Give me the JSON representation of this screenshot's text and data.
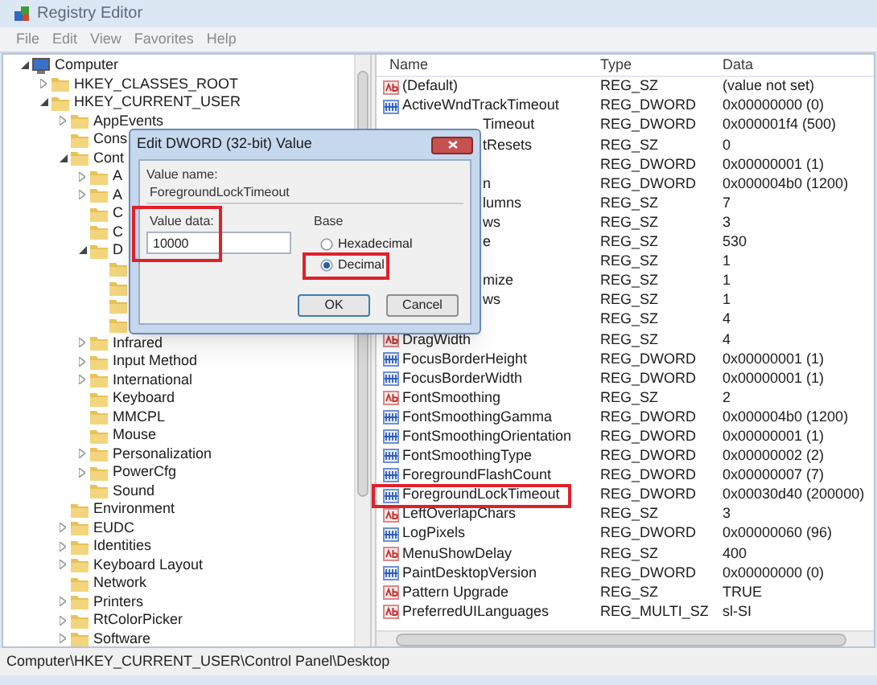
{
  "window": {
    "title": "Registry Editor"
  },
  "menu": [
    "File",
    "Edit",
    "View",
    "Favorites",
    "Help"
  ],
  "tree": [
    {
      "label": "Computer",
      "kind": "computer",
      "expanded": true,
      "children": [
        {
          "label": "HKEY_CLASSES_ROOT",
          "kind": "folder",
          "expanded": false
        },
        {
          "label": "HKEY_CURRENT_USER",
          "kind": "folder",
          "expanded": true,
          "children": [
            {
              "label": "AppEvents",
              "kind": "folder",
              "expanded": false
            },
            {
              "label": "Cons",
              "kind": "folder"
            },
            {
              "label": "Cont",
              "kind": "folder",
              "expanded": true,
              "children": [
                {
                  "label": "A",
                  "kind": "folder",
                  "expanded": false
                },
                {
                  "label": "A",
                  "kind": "folder",
                  "expanded": false
                },
                {
                  "label": "C",
                  "kind": "folder"
                },
                {
                  "label": "C",
                  "kind": "folder"
                },
                {
                  "label": "D",
                  "kind": "folder",
                  "expanded": true,
                  "children": [
                    {
                      "kind": "folder"
                    },
                    {
                      "kind": "folder"
                    },
                    {
                      "kind": "folder"
                    },
                    {
                      "kind": "folder"
                    }
                  ]
                },
                {
                  "label": "Infrared",
                  "kind": "folder",
                  "expanded": false
                },
                {
                  "label": "Input Method",
                  "kind": "folder",
                  "expanded": false
                },
                {
                  "label": "International",
                  "kind": "folder",
                  "expanded": false
                },
                {
                  "label": "Keyboard",
                  "kind": "folder"
                },
                {
                  "label": "MMCPL",
                  "kind": "folder"
                },
                {
                  "label": "Mouse",
                  "kind": "folder"
                },
                {
                  "label": "Personalization",
                  "kind": "folder",
                  "expanded": false
                },
                {
                  "label": "PowerCfg",
                  "kind": "folder",
                  "expanded": false
                },
                {
                  "label": "Sound",
                  "kind": "folder"
                }
              ]
            },
            {
              "label": "Environment",
              "kind": "folder"
            },
            {
              "label": "EUDC",
              "kind": "folder",
              "expanded": false
            },
            {
              "label": "Identities",
              "kind": "folder",
              "expanded": false
            },
            {
              "label": "Keyboard Layout",
              "kind": "folder",
              "expanded": false
            },
            {
              "label": "Network",
              "kind": "folder"
            },
            {
              "label": "Printers",
              "kind": "folder",
              "expanded": false
            },
            {
              "label": "RtColorPicker",
              "kind": "folder",
              "expanded": false
            },
            {
              "label": "Software",
              "kind": "folder",
              "expanded": false
            }
          ]
        }
      ]
    }
  ],
  "list": {
    "columns": [
      "Name",
      "Type",
      "Data"
    ],
    "rows": [
      {
        "kind": "string",
        "name": "(Default)",
        "type": "REG_SZ",
        "data": "(value not set)",
        "highlighted": false
      },
      {
        "kind": "dword",
        "name": "ActiveWndTrackTimeout",
        "type": "REG_DWORD",
        "data": "0x00000000 (0)",
        "highlighted": false
      },
      {
        "name": "Timeout",
        "type": "REG_DWORD",
        "data": "0x000001f4 (500)",
        "highlighted": false
      },
      {
        "name": "tResets",
        "type": "REG_SZ",
        "data": "0",
        "highlighted": false
      },
      {
        "type": "REG_DWORD",
        "data": "0x00000001 (1)",
        "highlighted": false
      },
      {
        "name": "n",
        "type": "REG_DWORD",
        "data": "0x000004b0 (1200)",
        "highlighted": false
      },
      {
        "name": "lumns",
        "type": "REG_SZ",
        "data": "7",
        "highlighted": false
      },
      {
        "name": "ws",
        "type": "REG_SZ",
        "data": "3",
        "highlighted": false
      },
      {
        "name": "e",
        "type": "REG_SZ",
        "data": "530",
        "highlighted": false
      },
      {
        "type": "REG_SZ",
        "data": "1",
        "highlighted": false
      },
      {
        "name": "mize",
        "type": "REG_SZ",
        "data": "1",
        "highlighted": false
      },
      {
        "name": "ws",
        "type": "REG_SZ",
        "data": "1",
        "highlighted": false
      },
      {
        "type": "REG_SZ",
        "data": "4",
        "highlighted": false
      },
      {
        "kind": "string",
        "name": "DragWidth",
        "type": "REG_SZ",
        "data": "4",
        "highlighted": false
      },
      {
        "kind": "dword",
        "name": "FocusBorderHeight",
        "type": "REG_DWORD",
        "data": "0x00000001 (1)",
        "highlighted": false
      },
      {
        "kind": "dword",
        "name": "FocusBorderWidth",
        "type": "REG_DWORD",
        "data": "0x00000001 (1)",
        "highlighted": false
      },
      {
        "kind": "string",
        "name": "FontSmoothing",
        "type": "REG_SZ",
        "data": "2",
        "highlighted": false
      },
      {
        "kind": "dword",
        "name": "FontSmoothingGamma",
        "type": "REG_DWORD",
        "data": "0x000004b0 (1200)",
        "highlighted": false
      },
      {
        "kind": "dword",
        "name": "FontSmoothingOrientation",
        "type": "REG_DWORD",
        "data": "0x00000001 (1)",
        "highlighted": false
      },
      {
        "kind": "dword",
        "name": "FontSmoothingType",
        "type": "REG_DWORD",
        "data": "0x00000002 (2)",
        "highlighted": false
      },
      {
        "kind": "dword",
        "name": "ForegroundFlashCount",
        "type": "REG_DWORD",
        "data": "0x00000007 (7)",
        "highlighted": false
      },
      {
        "kind": "dword",
        "name": "ForegroundLockTimeout",
        "type": "REG_DWORD",
        "data": "0x00030d40 (200000)",
        "highlighted": true
      },
      {
        "kind": "string",
        "name": "LeftOverlapChars",
        "type": "REG_SZ",
        "data": "3",
        "highlighted": false
      },
      {
        "kind": "dword",
        "name": "LogPixels",
        "type": "REG_DWORD",
        "data": "0x00000060 (96)",
        "highlighted": false
      },
      {
        "kind": "string",
        "name": "MenuShowDelay",
        "type": "REG_SZ",
        "data": "400",
        "highlighted": false
      },
      {
        "kind": "dword",
        "name": "PaintDesktopVersion",
        "type": "REG_DWORD",
        "data": "0x00000000 (0)",
        "highlighted": false
      },
      {
        "kind": "string",
        "name": "Pattern Upgrade",
        "type": "REG_SZ",
        "data": "TRUE",
        "highlighted": false
      },
      {
        "kind": "string",
        "name": "PreferredUILanguages",
        "type": "REG_MULTI_SZ",
        "data": "sl-SI",
        "highlighted": false
      }
    ]
  },
  "dialog": {
    "title": "Edit DWORD (32-bit) Value",
    "value_name_label": "Value name:",
    "value_name": "ForegroundLockTimeout",
    "value_data_label": "Value data:",
    "value_data": "10000",
    "value_data_highlighted": true,
    "base_label": "Base",
    "base_options": [
      {
        "label": "Hexadecimal",
        "selected": false,
        "highlighted": false
      },
      {
        "label": "Decimal",
        "selected": true,
        "highlighted": true
      }
    ],
    "buttons": [
      {
        "label": "OK",
        "default": true
      },
      {
        "label": "Cancel",
        "default": false
      }
    ]
  },
  "status_bar": "Computer\\HKEY_CURRENT_USER\\Control Panel\\Desktop"
}
